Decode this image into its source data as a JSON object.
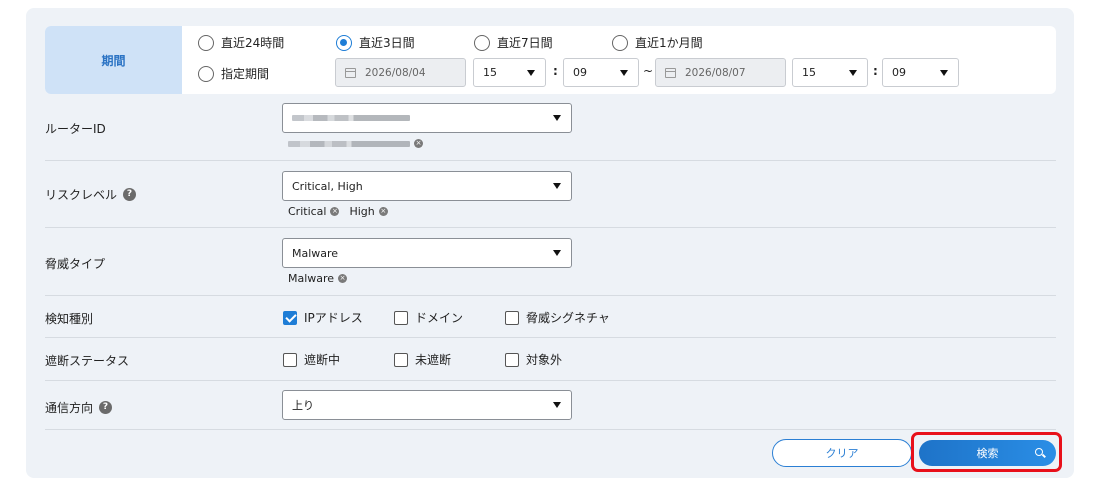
{
  "period": {
    "label": "期間",
    "options": [
      {
        "label": "直近24時間",
        "checked": false
      },
      {
        "label": "直近3日間",
        "checked": true
      },
      {
        "label": "直近7日間",
        "checked": false
      },
      {
        "label": "直近1か月間",
        "checked": false
      },
      {
        "label": "指定期間",
        "checked": false
      }
    ],
    "start_date": "2026/08/04",
    "start_hour": "15",
    "start_minute": "09",
    "range_separator": "~",
    "end_date": "2026/08/07",
    "end_hour": "15",
    "end_minute": "09",
    "time_separator": ":"
  },
  "router": {
    "label": "ルーターID",
    "selected_value": "(redacted)",
    "tags": [
      "(redacted)"
    ]
  },
  "risk_level": {
    "label": "リスクレベル",
    "help_icon": "?",
    "selected_value": "Critical, High",
    "tags": [
      "Critical",
      "High"
    ]
  },
  "threat_type": {
    "label": "脅威タイプ",
    "selected_value": "Malware",
    "tags": [
      "Malware"
    ]
  },
  "detection_type": {
    "label": "検知種別",
    "options": [
      {
        "label": "IPアドレス",
        "checked": true
      },
      {
        "label": "ドメイン",
        "checked": false
      },
      {
        "label": "脅威シグネチャ",
        "checked": false
      }
    ]
  },
  "block_status": {
    "label": "遮断ステータス",
    "options": [
      {
        "label": "遮断中",
        "checked": false
      },
      {
        "label": "未遮断",
        "checked": false
      },
      {
        "label": "対象外",
        "checked": false
      }
    ]
  },
  "direction": {
    "label": "通信方向",
    "help_icon": "?",
    "selected_value": "上り"
  },
  "actions": {
    "clear_label": "クリア",
    "search_label": "検索"
  },
  "icons": {
    "calendar": "calendar-icon",
    "dropdown": "chevron-down-icon",
    "remove_tag": "close-circle-icon",
    "search": "search-icon"
  },
  "colors": {
    "accent": "#1e7dd6",
    "highlight": "#e8101a",
    "panel_bg": "#eef2f7"
  }
}
